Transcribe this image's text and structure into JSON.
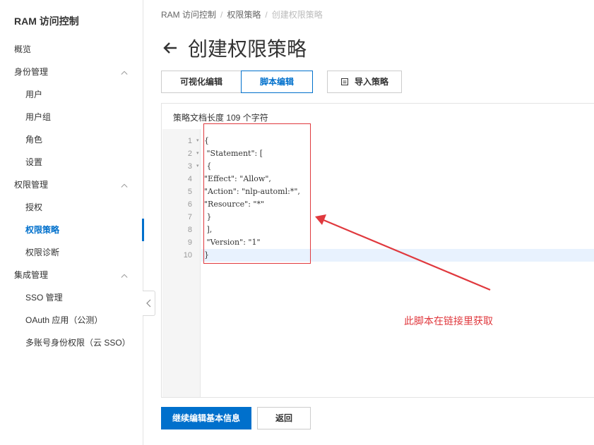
{
  "sidebar": {
    "title": "RAM 访问控制",
    "items": [
      {
        "label": "概览",
        "type": "top"
      },
      {
        "label": "身份管理",
        "type": "group"
      },
      {
        "label": "用户",
        "type": "sub"
      },
      {
        "label": "用户组",
        "type": "sub"
      },
      {
        "label": "角色",
        "type": "sub"
      },
      {
        "label": "设置",
        "type": "sub"
      },
      {
        "label": "权限管理",
        "type": "group"
      },
      {
        "label": "授权",
        "type": "sub"
      },
      {
        "label": "权限策略",
        "type": "sub",
        "active": true
      },
      {
        "label": "权限诊断",
        "type": "sub"
      },
      {
        "label": "集成管理",
        "type": "group"
      },
      {
        "label": "SSO 管理",
        "type": "sub"
      },
      {
        "label": "OAuth 应用（公测）",
        "type": "sub"
      },
      {
        "label": "多账号身份权限（云 SSO）",
        "type": "sub"
      }
    ]
  },
  "breadcrumb": {
    "items": [
      "RAM 访问控制",
      "权限策略",
      "创建权限策略"
    ]
  },
  "page": {
    "title": "创建权限策略"
  },
  "tabs": [
    {
      "label": "可视化编辑",
      "active": false
    },
    {
      "label": "脚本编辑",
      "active": true
    }
  ],
  "import_button": {
    "label": "导入策略"
  },
  "editor": {
    "doc_length": "策略文档长度 109 个字符",
    "lines": [
      {
        "num": "1",
        "fold": true,
        "text": "{"
      },
      {
        "num": "2",
        "fold": true,
        "text": " \"Statement\": ["
      },
      {
        "num": "3",
        "fold": true,
        "text": " {"
      },
      {
        "num": "4",
        "fold": false,
        "text": "\"Effect\": \"Allow\","
      },
      {
        "num": "5",
        "fold": false,
        "text": "\"Action\": \"nlp-automl:*\","
      },
      {
        "num": "6",
        "fold": false,
        "text": "\"Resource\": \"*\""
      },
      {
        "num": "7",
        "fold": false,
        "text": " }"
      },
      {
        "num": "8",
        "fold": false,
        "text": " ],"
      },
      {
        "num": "9",
        "fold": false,
        "text": " \"Version\": \"1\""
      },
      {
        "num": "10",
        "fold": false,
        "text": "}"
      }
    ]
  },
  "annotation": {
    "text": "此脚本在链接里获取"
  },
  "footer": {
    "primary_label": "继续编辑基本信息",
    "secondary_label": "返回"
  },
  "colors": {
    "accent": "#0070cc",
    "annotation": "#e0393e"
  }
}
